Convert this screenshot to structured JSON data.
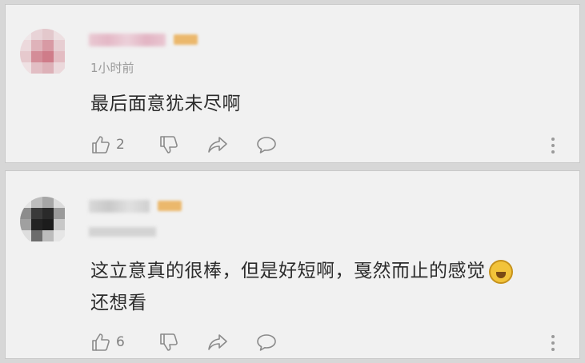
{
  "comments": [
    {
      "time": "1小时前",
      "text": "最后面意犹未尽啊",
      "like_count": "2",
      "icons": [
        "thumbs-up-icon",
        "thumbs-down-icon",
        "share-icon",
        "comment-icon",
        "more-icon"
      ]
    },
    {
      "time": "",
      "text_line1": "这立意真的很棒，但是好短啊，戛然而止的感觉",
      "text_line2": "还想看",
      "emoji": "crying-laughing-emoji",
      "like_count": "6",
      "icons": [
        "thumbs-up-icon",
        "thumbs-down-icon",
        "share-icon",
        "comment-icon",
        "more-icon"
      ]
    }
  ],
  "colors": {
    "card_bg": "#f1f1f1",
    "text": "#2c2c2c",
    "meta": "#9a9a9a",
    "badge": "#ebb86c"
  }
}
